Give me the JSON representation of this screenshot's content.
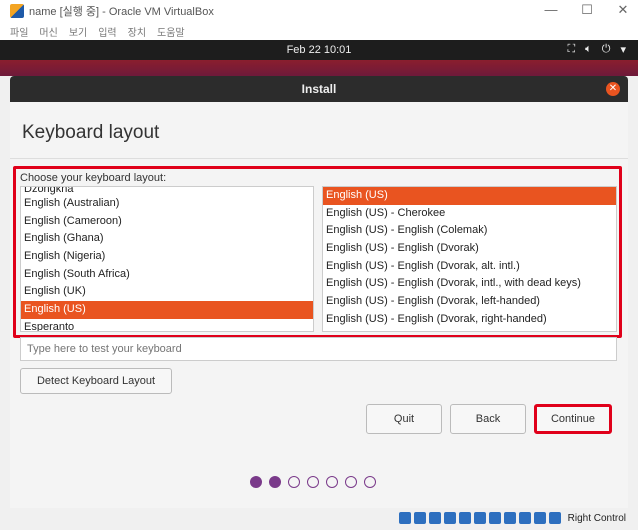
{
  "window": {
    "title": "name [실행 중] - Oracle VM VirtualBox"
  },
  "menu": [
    "파일",
    "머신",
    "보기",
    "입력",
    "장치",
    "도움말"
  ],
  "topbar": {
    "clock": "Feb 22  10:01"
  },
  "installer": {
    "header": "Install",
    "page_title": "Keyboard layout",
    "choose_label": "Choose your keyboard layout:",
    "layouts": [
      {
        "label": "Dzongkha",
        "selected": false
      },
      {
        "label": "English (Australian)",
        "selected": false
      },
      {
        "label": "English (Cameroon)",
        "selected": false
      },
      {
        "label": "English (Ghana)",
        "selected": false
      },
      {
        "label": "English (Nigeria)",
        "selected": false
      },
      {
        "label": "English (South Africa)",
        "selected": false
      },
      {
        "label": "English (UK)",
        "selected": false
      },
      {
        "label": "English (US)",
        "selected": true
      },
      {
        "label": "Esperanto",
        "selected": false
      }
    ],
    "variants": [
      {
        "label": "English (US)",
        "selected": true
      },
      {
        "label": "English (US) - Cherokee",
        "selected": false
      },
      {
        "label": "English (US) - English (Colemak)",
        "selected": false
      },
      {
        "label": "English (US) - English (Dvorak)",
        "selected": false
      },
      {
        "label": "English (US) - English (Dvorak, alt. intl.)",
        "selected": false
      },
      {
        "label": "English (US) - English (Dvorak, intl., with dead keys)",
        "selected": false
      },
      {
        "label": "English (US) - English (Dvorak, left-handed)",
        "selected": false
      },
      {
        "label": "English (US) - English (Dvorak, right-handed)",
        "selected": false
      }
    ],
    "test_placeholder": "Type here to test your keyboard",
    "detect_label": "Detect Keyboard Layout",
    "quit_label": "Quit",
    "back_label": "Back",
    "continue_label": "Continue",
    "progress": {
      "current_step": 2,
      "total_steps": 7
    }
  },
  "statusbar": {
    "host_key": "Right Control"
  },
  "colors": {
    "accent": "#e95420",
    "highlight_outline": "#e0001a",
    "progress_dot": "#7a3a8a"
  }
}
